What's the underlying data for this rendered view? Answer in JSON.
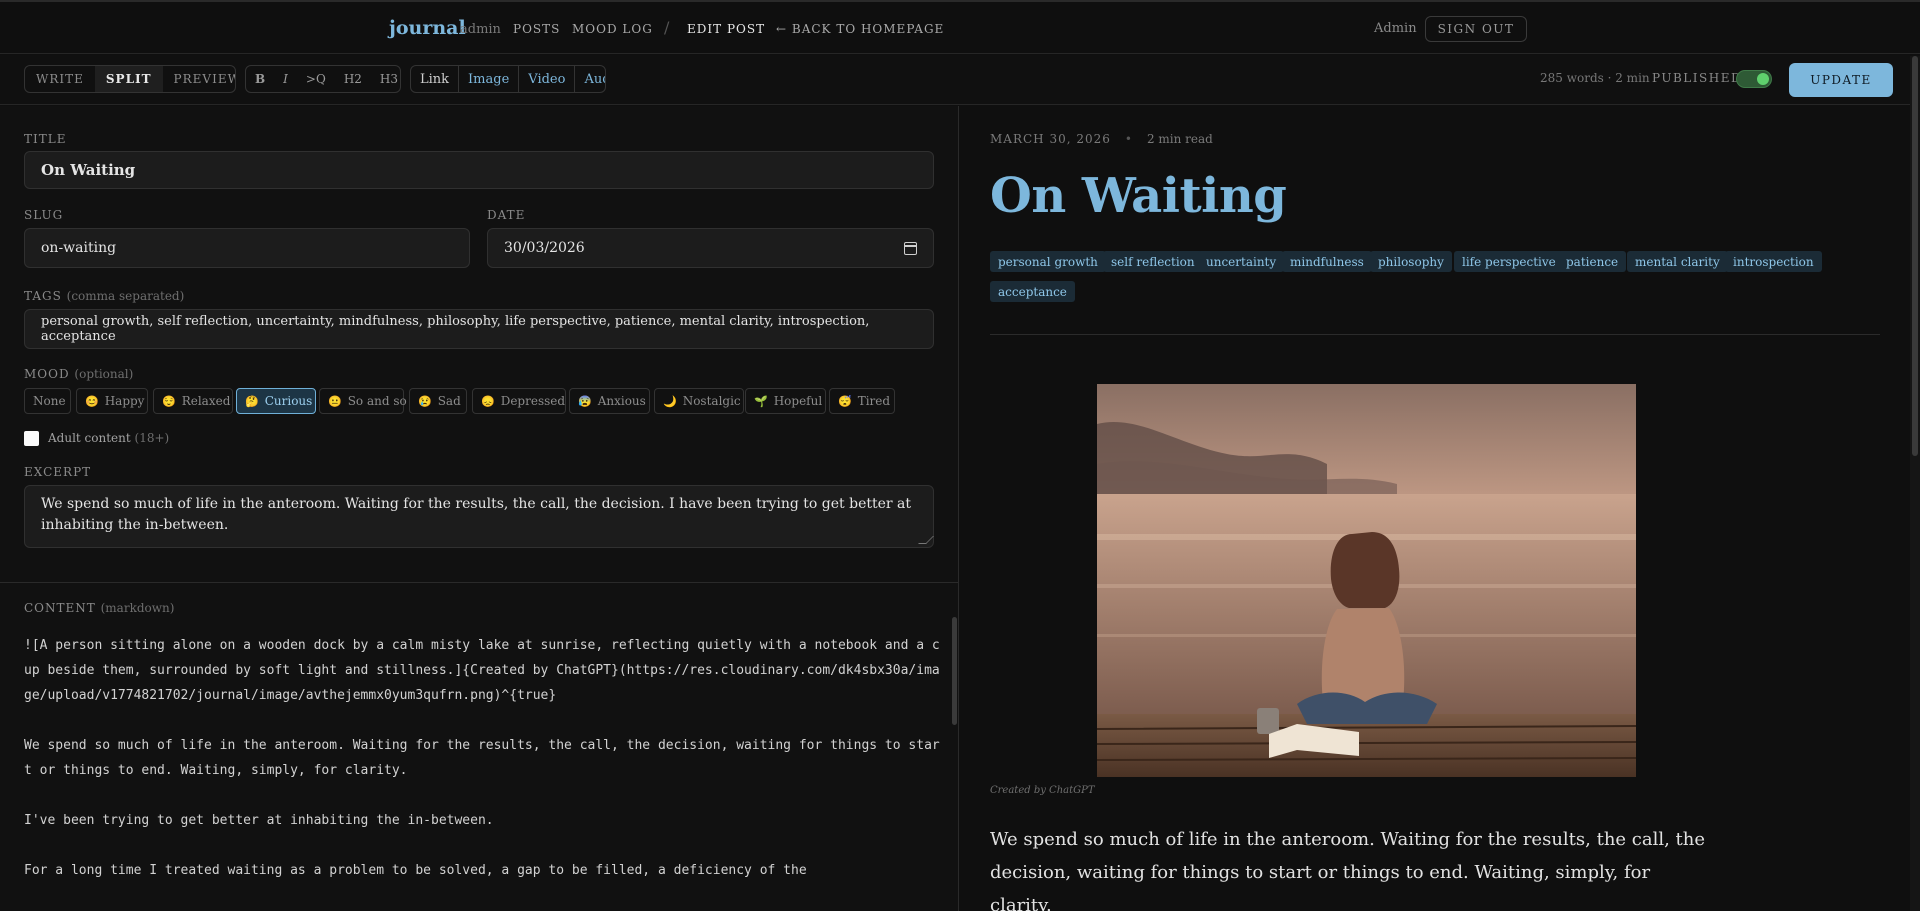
{
  "nav": {
    "brand": "journal",
    "brand_sub": "admin",
    "links": [
      "POSTS",
      "MOOD LOG"
    ],
    "separator": "/",
    "current": "EDIT POST",
    "back": "← BACK TO HOMEPAGE",
    "user": "Admin",
    "signout": "SIGN OUT"
  },
  "toolbar": {
    "modes": [
      "WRITE",
      "SPLIT",
      "PREVIEW"
    ],
    "active_mode": "SPLIT",
    "format": [
      "B",
      "I",
      ">Q",
      "H2",
      "H3"
    ],
    "media": [
      "Link",
      "Image",
      "Video",
      "Audio"
    ],
    "word_count": "285 words · 2 min",
    "published_label": "PUBLISHED",
    "published": true,
    "update": "UPDATE"
  },
  "form": {
    "title_label": "TITLE",
    "title": "On Waiting",
    "slug_label": "SLUG",
    "slug": "on-waiting",
    "date_label": "DATE",
    "date": "30/03/2026",
    "tags_label": "TAGS",
    "tags_hint": "(comma separated)",
    "tags": "personal growth, self reflection, uncertainty, mindfulness, philosophy, life perspective, patience, mental clarity, introspection, acceptance",
    "mood_label": "MOOD",
    "mood_hint": "(optional)",
    "moods": [
      {
        "icon": "",
        "label": "None"
      },
      {
        "icon": "😊",
        "label": "Happy"
      },
      {
        "icon": "😌",
        "label": "Relaxed"
      },
      {
        "icon": "🤔",
        "label": "Curious"
      },
      {
        "icon": "😐",
        "label": "So and so"
      },
      {
        "icon": "😢",
        "label": "Sad"
      },
      {
        "icon": "😞",
        "label": "Depressed"
      },
      {
        "icon": "😰",
        "label": "Anxious"
      },
      {
        "icon": "🌙",
        "label": "Nostalgic"
      },
      {
        "icon": "🌱",
        "label": "Hopeful"
      },
      {
        "icon": "😴",
        "label": "Tired"
      }
    ],
    "selected_mood": "Curious",
    "adult_label": "Adult content",
    "adult_hint": "(18+)",
    "adult": false,
    "excerpt_label": "EXCERPT",
    "excerpt": "We spend so much of life in the anteroom. Waiting for the results, the call, the decision. I have been trying to get better at inhabiting the in-between.",
    "content_label": "CONTENT",
    "content_hint": "(markdown)",
    "content": "![A person sitting alone on a wooden dock by a calm misty lake at sunrise, reflecting quietly with a notebook and a cup beside them, surrounded by soft light and stillness.]{Created by ChatGPT}(https://res.cloudinary.com/dk4sbx30a/image/upload/v1774821702/journal/image/avthejemmx0yum3qufrn.png)^{true}\n\nWe spend so much of life in the anteroom. Waiting for the results, the call, the decision, waiting for things to start or things to end. Waiting, simply, for clarity.\n\nI've been trying to get better at inhabiting the in-between.\n\nFor a long time I treated waiting as a problem to be solved, a gap to be filled, a deficiency of the"
  },
  "preview": {
    "date": "MARCH 30, 2026",
    "read": "2 min read",
    "title": "On Waiting",
    "tags": [
      "personal growth",
      "self reflection",
      "uncertainty",
      "mindfulness",
      "philosophy",
      "life perspective",
      "patience",
      "mental clarity",
      "introspection",
      "acceptance"
    ],
    "caption": "Created by ChatGPT",
    "body": "We spend so much of life in the anteroom. Waiting for the results, the call, the decision, waiting for things to start or things to end. Waiting, simply, for clarity."
  },
  "colors": {
    "accent": "#7db7dc",
    "background": "#0f0f0f",
    "toggle_on": "#5fd06d"
  }
}
